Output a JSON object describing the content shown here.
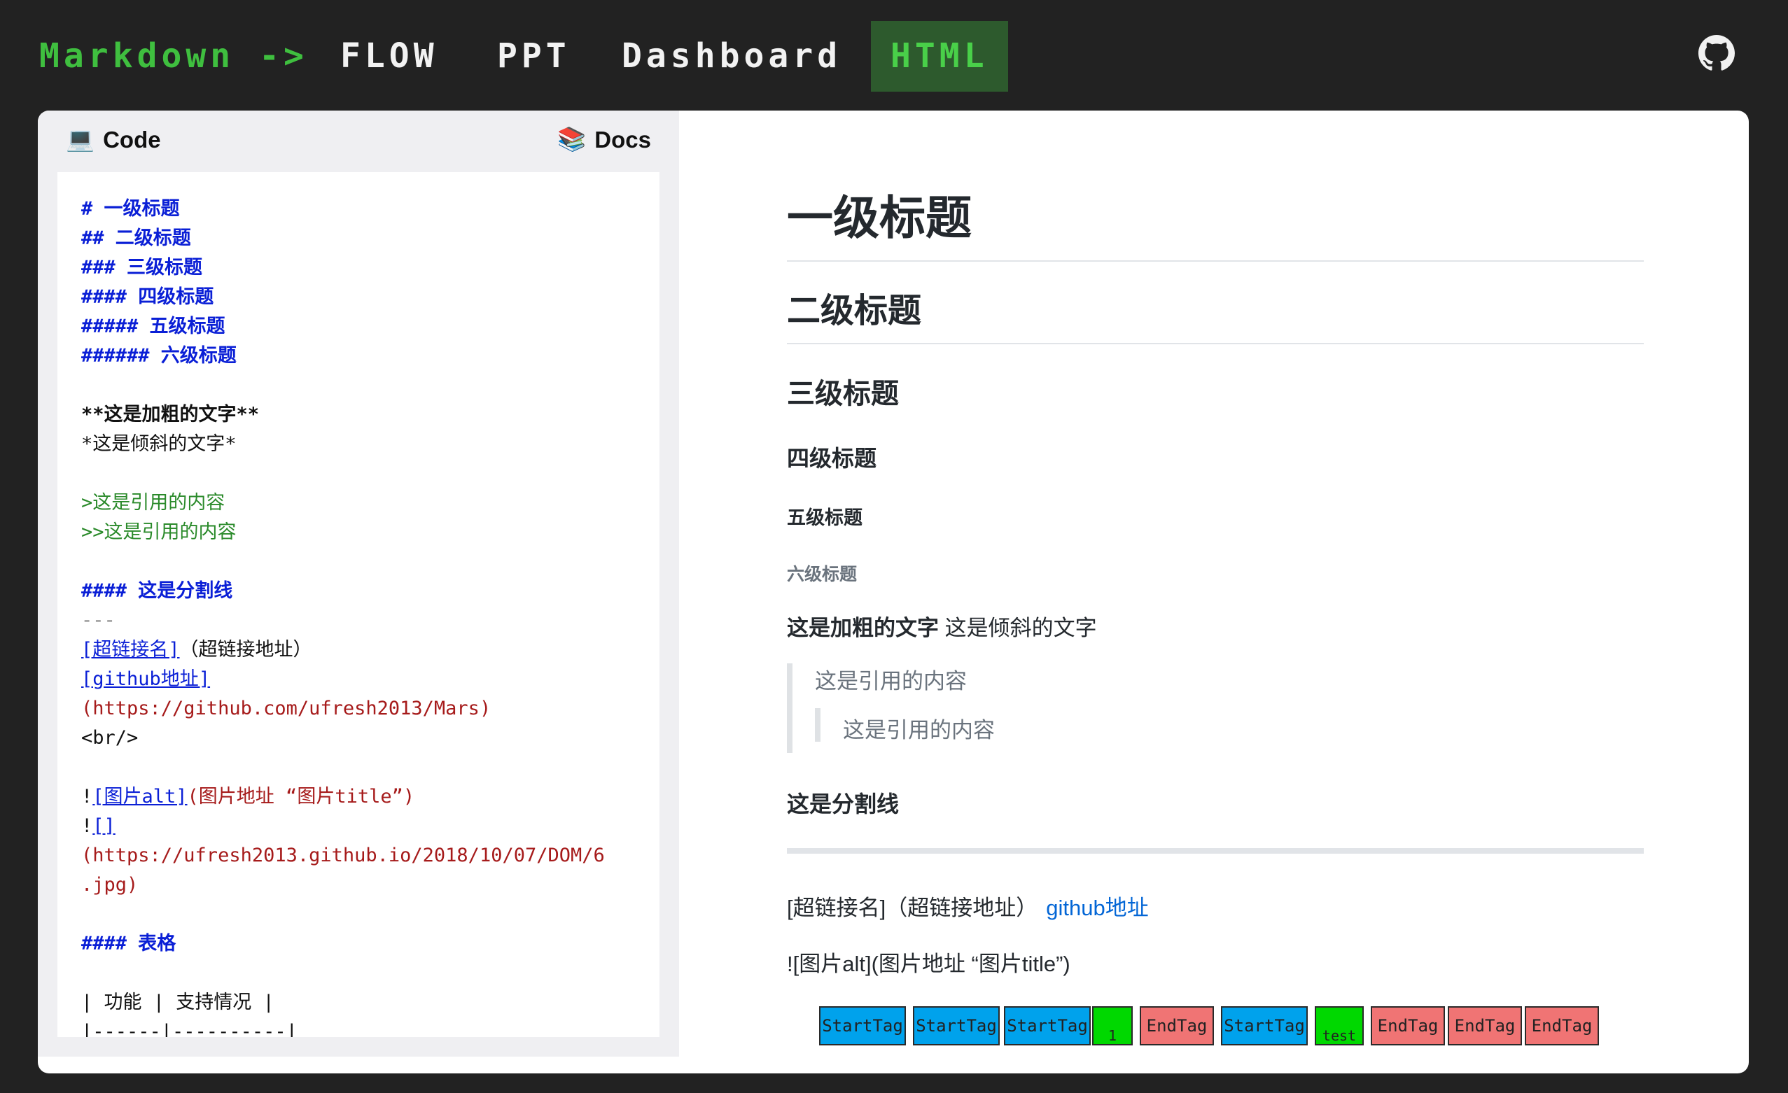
{
  "nav": {
    "brand": "Markdown ->",
    "tabs": [
      {
        "label": "FLOW",
        "active": false
      },
      {
        "label": "PPT",
        "active": false
      },
      {
        "label": "Dashboard",
        "active": false
      },
      {
        "label": "HTML",
        "active": true
      }
    ],
    "github_icon": "github-icon"
  },
  "left_pane": {
    "code_tab": {
      "label": "Code",
      "icon": "💻"
    },
    "docs_tab": {
      "label": "Docs",
      "icon": "📚"
    },
    "lines": [
      "# 一级标题",
      "## 二级标题",
      "### 三级标题",
      "#### 四级标题",
      "##### 五级标题",
      "###### 六级标题",
      "",
      "**这是加粗的文字**",
      "*这是倾斜的文字*",
      "",
      ">这是引用的内容",
      ">>这是引用的内容",
      "",
      "#### 这是分割线",
      "---",
      "[超链接名]（超链接地址）",
      "[github地址]",
      "(https://github.com/ufresh2013/Mars)",
      "<br/>",
      "",
      "![图片alt](图片地址 “图片title”)",
      "![]",
      "(https://ufresh2013.github.io/2018/10/07/DOM/6",
      ".jpg)",
      "",
      "#### 表格",
      "",
      "| 功能 | 支持情况 |",
      "|------|----------|"
    ]
  },
  "preview": {
    "h1": "一级标题",
    "h2": "二级标题",
    "h3": "三级标题",
    "h4": "四级标题",
    "h5": "五级标题",
    "h6": "六级标题",
    "bold_text": "这是加粗的文字",
    "italic_text": "这是倾斜的文字",
    "quote1": "这是引用的内容",
    "quote2": "这是引用的内容",
    "divider_heading": "这是分割线",
    "link_line_text": "[超链接名]（超链接地址）",
    "link_label": "github地址",
    "image_line": "![图片alt](图片地址 “图片title”)",
    "tags": [
      {
        "label": "StartTag",
        "kind": "start"
      },
      {
        "label": "StartTag",
        "kind": "start"
      },
      {
        "label": "StartTag",
        "kind": "start"
      },
      {
        "label": "1",
        "kind": "text"
      },
      {
        "label": "EndTag",
        "kind": "end"
      },
      {
        "label": "StartTag",
        "kind": "start"
      },
      {
        "label": "test",
        "kind": "text"
      },
      {
        "label": "EndTag",
        "kind": "end"
      },
      {
        "label": "EndTag",
        "kind": "end"
      },
      {
        "label": "EndTag",
        "kind": "end"
      }
    ]
  },
  "colors": {
    "page_bg": "#222222",
    "brand_green": "#3fbf3f",
    "active_tab_bg": "#2d5a2d",
    "start_tag": "#00a2ec",
    "end_tag": "#f07474",
    "text_tag": "#00d800",
    "link_blue": "#0366d6"
  }
}
